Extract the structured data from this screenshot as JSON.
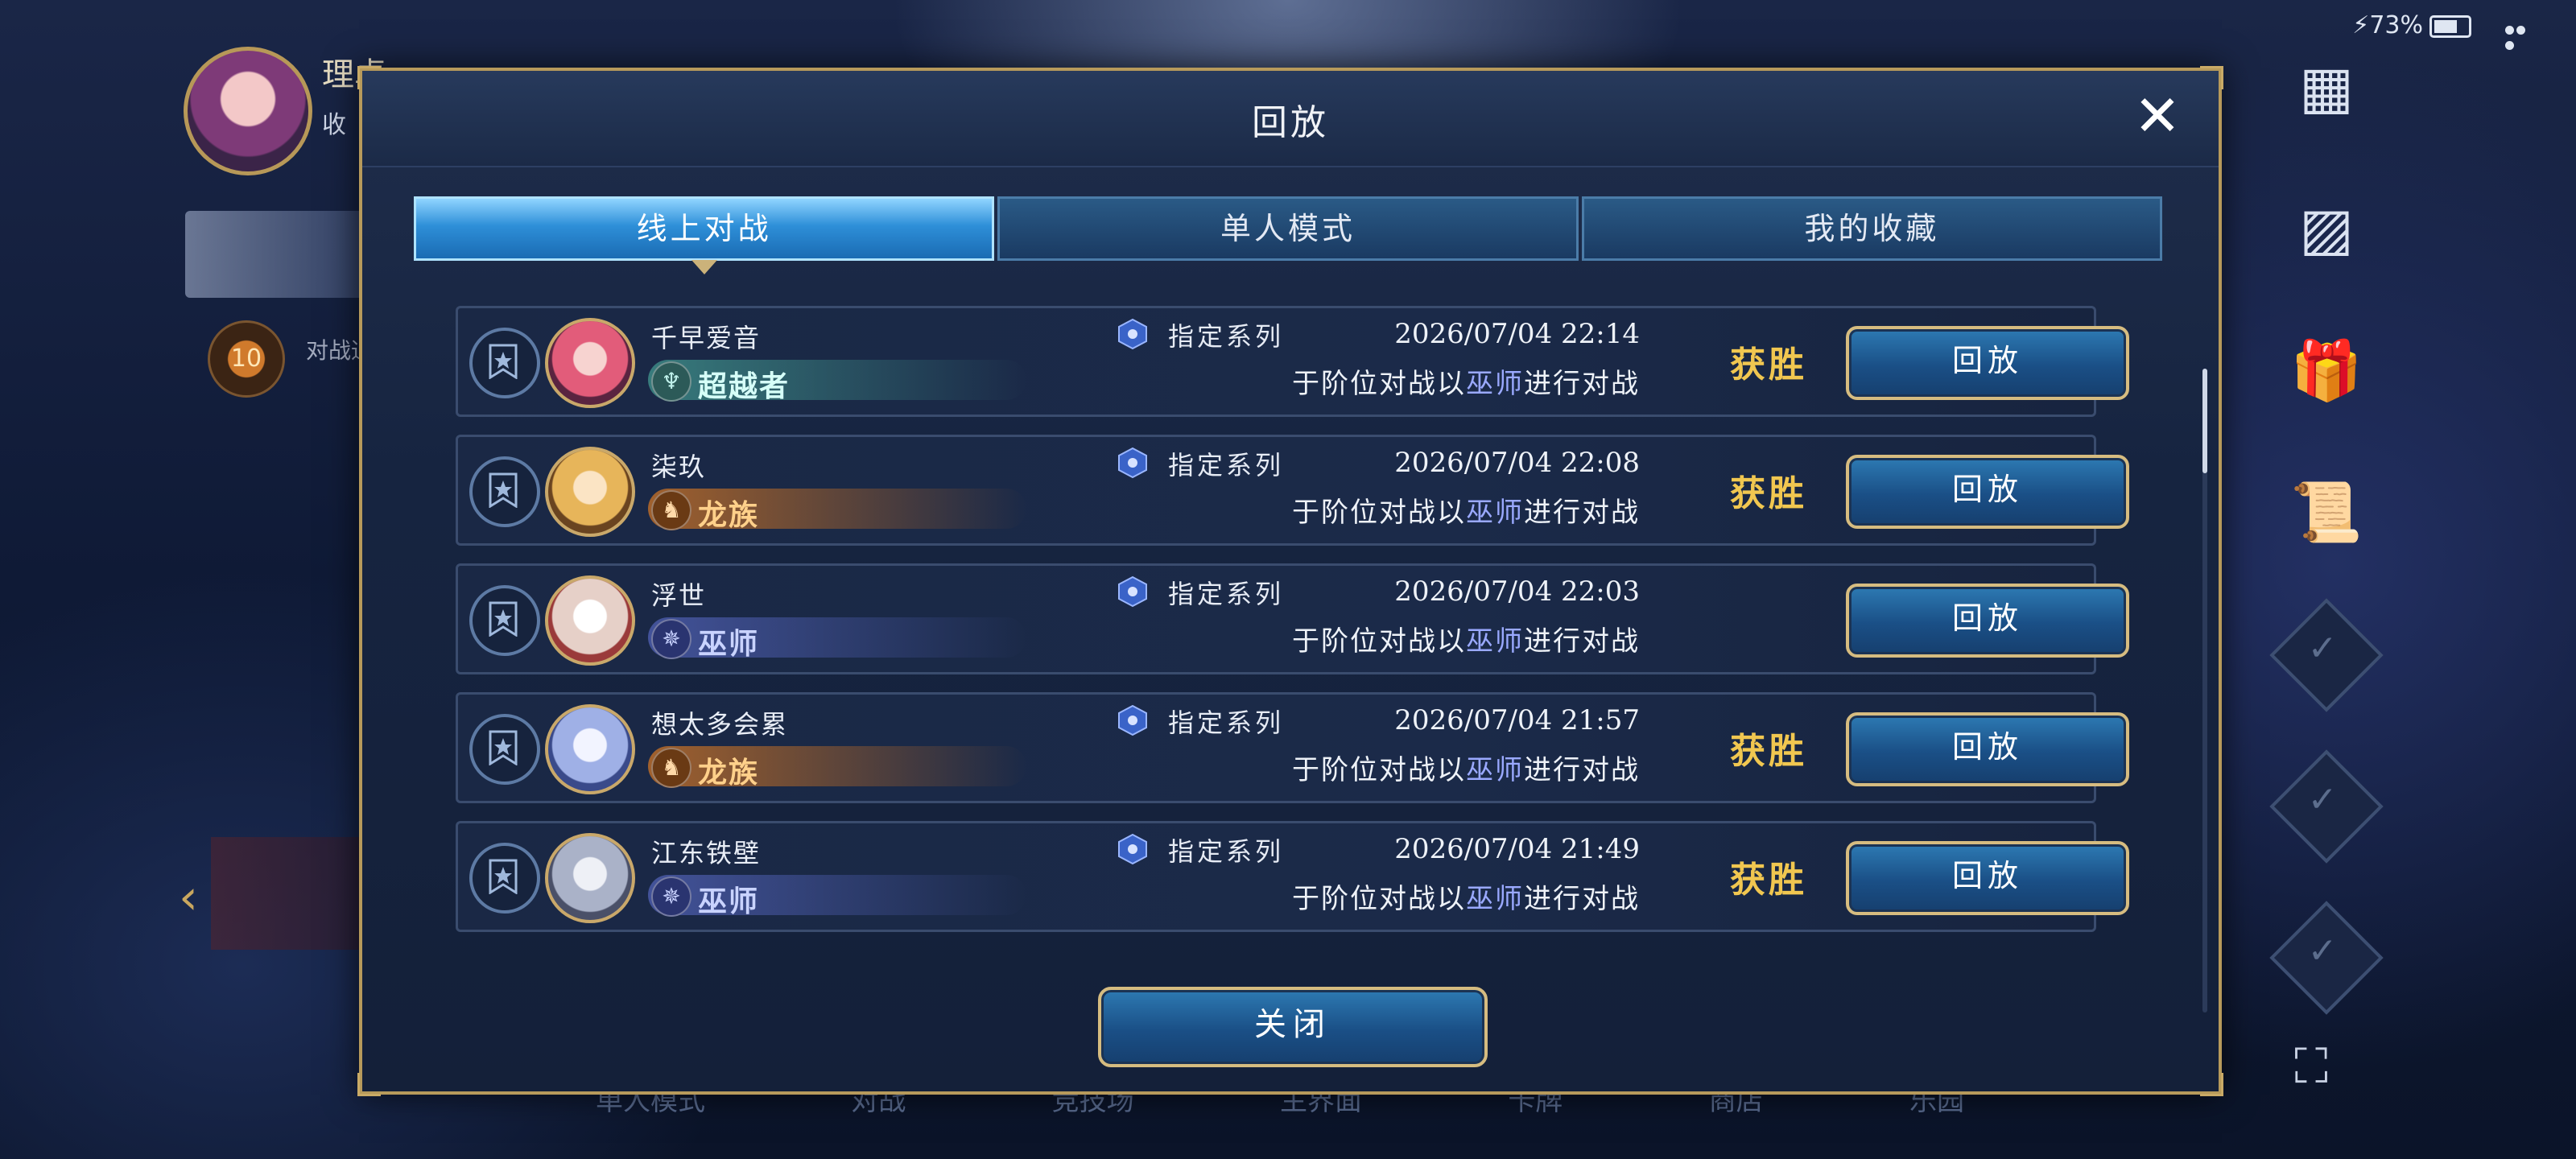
{
  "status_bar": {
    "battery": "73%"
  },
  "background": {
    "player_name": "理卓",
    "player_tag": "收",
    "level": "10",
    "level_text": "对战通行证",
    "bottom_nav": [
      "单人模式",
      "对战",
      "竞技场",
      "主界面",
      "卡牌",
      "商店",
      "乐园"
    ]
  },
  "dialog": {
    "title": "回放",
    "tabs": [
      {
        "label": "线上对战",
        "active": true
      },
      {
        "label": "单人模式",
        "active": false
      },
      {
        "label": "我的收藏",
        "active": false
      }
    ],
    "replays": [
      {
        "opponent": "千早爱音",
        "class": "超越者",
        "class_icon": "transcendent-icon",
        "deck": "指定系列",
        "datetime": "2026/07/04  22:14",
        "desc_prefix": "于阶位对战以",
        "desc_class": "巫师",
        "desc_suffix": "进行对战",
        "result": "获胜",
        "button": "回放"
      },
      {
        "opponent": "柒玖",
        "class": "龙族",
        "class_icon": "dragon-icon",
        "deck": "指定系列",
        "datetime": "2026/07/04  22:08",
        "desc_prefix": "于阶位对战以",
        "desc_class": "巫师",
        "desc_suffix": "进行对战",
        "result": "获胜",
        "button": "回放"
      },
      {
        "opponent": "浮世",
        "class": "巫师",
        "class_icon": "wizard-icon",
        "deck": "指定系列",
        "datetime": "2026/07/04  22:03",
        "desc_prefix": "于阶位对战以",
        "desc_class": "巫师",
        "desc_suffix": "进行对战",
        "result": "",
        "button": "回放"
      },
      {
        "opponent": "想太多会累",
        "class": "龙族",
        "class_icon": "dragon-icon",
        "deck": "指定系列",
        "datetime": "2026/07/04  21:57",
        "desc_prefix": "于阶位对战以",
        "desc_class": "巫师",
        "desc_suffix": "进行对战",
        "result": "获胜",
        "button": "回放"
      },
      {
        "opponent": "江东铁壁",
        "class": "巫师",
        "class_icon": "wizard-icon",
        "deck": "指定系列",
        "datetime": "2026/07/04  21:49",
        "desc_prefix": "于阶位对战以",
        "desc_class": "巫师",
        "desc_suffix": "进行对战",
        "result": "获胜",
        "button": "回放"
      }
    ],
    "close_button": "关闭"
  },
  "colors": {
    "gold": "#b79a5b",
    "win": "#f1c750",
    "transcendent": "#3d8a86",
    "dragon": "#b0672a",
    "wizard": "#4a5aa8"
  }
}
